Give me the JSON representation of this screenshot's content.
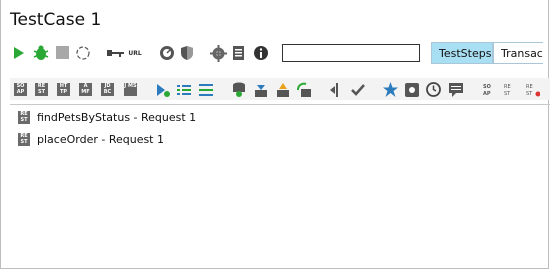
{
  "title": "TestCase 1",
  "search": {
    "value": ""
  },
  "tabs": {
    "active": "TestSteps",
    "next": "Transactions"
  },
  "toolbar": {
    "url_label": "URL"
  },
  "steps": [
    {
      "label": "findPetsByStatus - Request 1"
    },
    {
      "label": "placeOrder - Request 1"
    }
  ],
  "step_buttons": [
    {
      "text": "SO AP"
    },
    {
      "text": "RE ST"
    },
    {
      "text": "HT TP"
    },
    {
      "text": "A MF"
    },
    {
      "text": "JD BC"
    },
    {
      "text": "J MS"
    }
  ],
  "colors": {
    "tab_active": "#a9dff2",
    "run_green": "#2aa836"
  }
}
